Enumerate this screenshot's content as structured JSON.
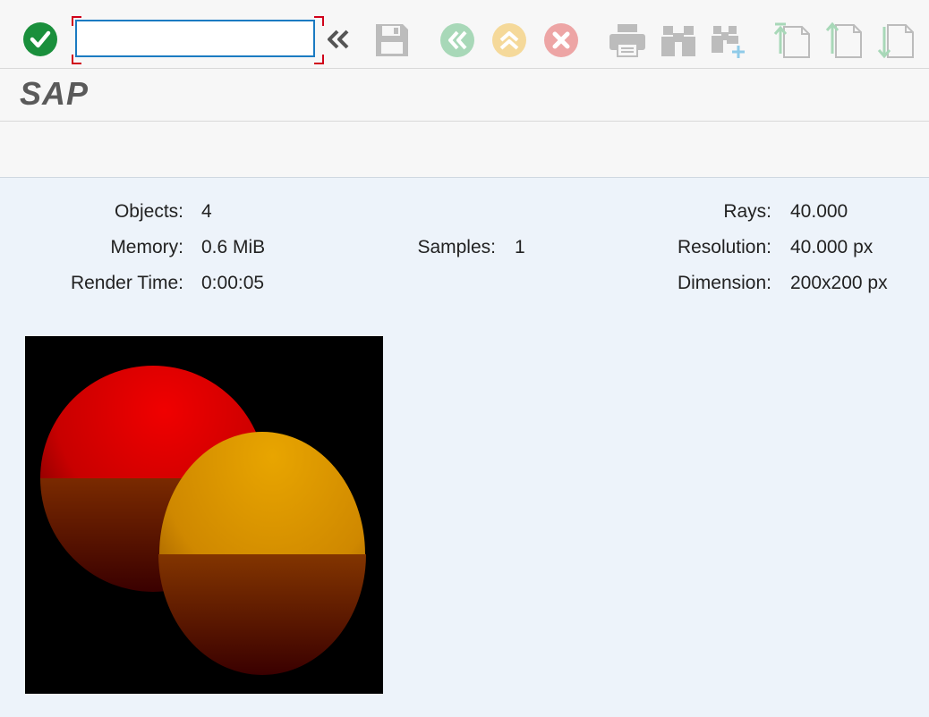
{
  "toolbar": {
    "command_value": "",
    "buttons": [
      {
        "name": "enter",
        "icon": "check-circle-icon",
        "color": "#1a8f3c",
        "enabled": true
      },
      {
        "name": "collapse",
        "icon": "double-chevron-left-icon",
        "enabled": true
      },
      {
        "name": "save",
        "icon": "save-icon",
        "enabled": false
      },
      {
        "name": "back",
        "icon": "back-icon",
        "color": "#a8d8b8",
        "enabled": false
      },
      {
        "name": "exit",
        "icon": "exit-icon",
        "color": "#f5d99a",
        "enabled": false
      },
      {
        "name": "cancel",
        "icon": "cancel-icon",
        "color": "#eda5a5",
        "enabled": false
      },
      {
        "name": "print",
        "icon": "print-icon",
        "enabled": false
      },
      {
        "name": "find",
        "icon": "binoculars-icon",
        "enabled": false
      },
      {
        "name": "find-next",
        "icon": "binoculars-plus-icon",
        "enabled": false
      },
      {
        "name": "first-page",
        "icon": "page-up-first-icon",
        "enabled": false
      },
      {
        "name": "previous-page",
        "icon": "page-up-icon",
        "enabled": false
      },
      {
        "name": "next-page",
        "icon": "page-down-icon",
        "enabled": false
      }
    ]
  },
  "brand": {
    "logo_text": "SAP"
  },
  "stats": {
    "objects_label": "Objects:",
    "objects_value": "4",
    "memory_label": "Memory:",
    "memory_value": "0.6 MiB",
    "render_time_label": "Render Time:",
    "render_time_value": "0:00:05",
    "samples_label": "Samples:",
    "samples_value": "1",
    "rays_label": "Rays:",
    "rays_value": "40.000",
    "resolution_label": "Resolution:",
    "resolution_value": "40.000 px",
    "dimension_label": "Dimension:",
    "dimension_value": "200x200 px"
  },
  "render_image": {
    "background": "#000000",
    "spheres": [
      {
        "name": "red-sphere",
        "top_color": "#e00000",
        "bottom_color": "#c07000"
      },
      {
        "name": "orange-sphere",
        "top_color": "#e0a000",
        "bottom_color": "#c07000"
      }
    ]
  }
}
